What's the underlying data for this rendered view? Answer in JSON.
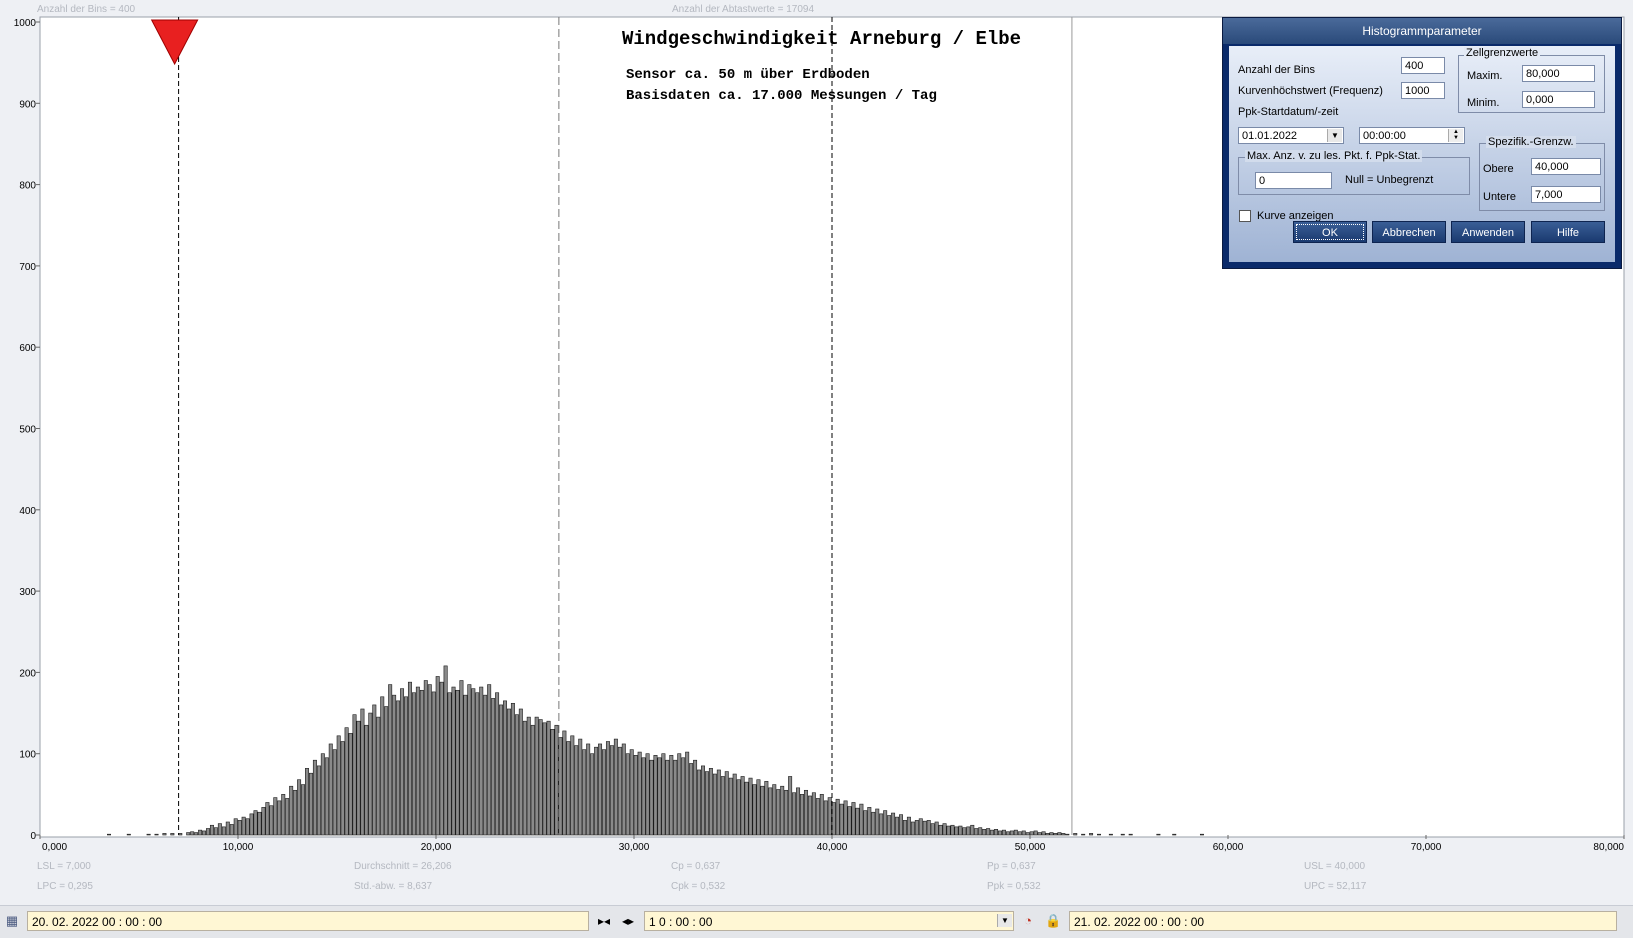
{
  "header": {
    "bins_info": "Anzahl der Bins =   400",
    "samples_info": "Anzahl der Abtastwerte = 17094"
  },
  "chart_title": {
    "line1": "Windgeschwindigkeit  Arneburg / Elbe",
    "line2": "Sensor ca. 50 m über Erdboden",
    "line3": "Basisdaten ca. 17.000 Messungen / Tag"
  },
  "stats": {
    "lsl": "LSL = 7,000",
    "lpc": "LPC = 0,295",
    "mean": "Durchschnitt  = 26,206",
    "std": "Std.-abw. = 8,637",
    "cp": "Cp  = 0,637",
    "cpk": "Cpk = 0,532",
    "pp": "Pp  = 0,637",
    "ppk": "Ppk = 0,532",
    "usl": "USL = 40,000",
    "upc": "UPC = 52,117"
  },
  "chart_data": {
    "type": "bar",
    "xlim": [
      0,
      80
    ],
    "ylim": [
      0,
      1000
    ],
    "xticks": [
      0,
      10,
      20,
      30,
      40,
      50,
      60,
      70,
      80
    ],
    "xtick_labels": [
      "0,000",
      "10,000",
      "20,000",
      "30,000",
      "40,000",
      "50,000",
      "60,000",
      "70,000",
      "80,000"
    ],
    "yticks": [
      0,
      100,
      200,
      300,
      400,
      500,
      600,
      700,
      800,
      900,
      1000
    ],
    "ytick_labels": [
      "0",
      "100",
      "200",
      "300",
      "400",
      "500",
      "600",
      "700",
      "800",
      "900",
      "1000"
    ],
    "bin_width": 0.2,
    "lsl": 7.0,
    "usl": 40.0,
    "mean": 26.206,
    "upc": 52.117,
    "marker_x": 6.8,
    "bins": [
      [
        3.4,
        1
      ],
      [
        4.4,
        1
      ],
      [
        5.4,
        1
      ],
      [
        5.8,
        1
      ],
      [
        6.2,
        2
      ],
      [
        6.6,
        2
      ],
      [
        7.0,
        2
      ],
      [
        7.4,
        3
      ],
      [
        7.6,
        4
      ],
      [
        7.8,
        3
      ],
      [
        8.0,
        6
      ],
      [
        8.2,
        5
      ],
      [
        8.4,
        8
      ],
      [
        8.6,
        12
      ],
      [
        8.8,
        9
      ],
      [
        9.0,
        14
      ],
      [
        9.2,
        10
      ],
      [
        9.4,
        16
      ],
      [
        9.6,
        13
      ],
      [
        9.8,
        20
      ],
      [
        10.0,
        18
      ],
      [
        10.2,
        22
      ],
      [
        10.4,
        20
      ],
      [
        10.6,
        26
      ],
      [
        10.8,
        30
      ],
      [
        11.0,
        28
      ],
      [
        11.2,
        34
      ],
      [
        11.4,
        40
      ],
      [
        11.6,
        36
      ],
      [
        11.8,
        46
      ],
      [
        12.0,
        42
      ],
      [
        12.2,
        50
      ],
      [
        12.4,
        45
      ],
      [
        12.6,
        60
      ],
      [
        12.8,
        55
      ],
      [
        13.0,
        68
      ],
      [
        13.2,
        62
      ],
      [
        13.4,
        82
      ],
      [
        13.6,
        76
      ],
      [
        13.8,
        92
      ],
      [
        14.0,
        85
      ],
      [
        14.2,
        100
      ],
      [
        14.4,
        95
      ],
      [
        14.6,
        112
      ],
      [
        14.8,
        105
      ],
      [
        15.0,
        122
      ],
      [
        15.2,
        115
      ],
      [
        15.4,
        132
      ],
      [
        15.6,
        125
      ],
      [
        15.8,
        148
      ],
      [
        16.0,
        140
      ],
      [
        16.2,
        155
      ],
      [
        16.4,
        135
      ],
      [
        16.6,
        150
      ],
      [
        16.8,
        160
      ],
      [
        17.0,
        145
      ],
      [
        17.2,
        170
      ],
      [
        17.4,
        158
      ],
      [
        17.6,
        185
      ],
      [
        17.8,
        172
      ],
      [
        18.0,
        165
      ],
      [
        18.2,
        180
      ],
      [
        18.4,
        170
      ],
      [
        18.6,
        188
      ],
      [
        18.8,
        175
      ],
      [
        19.0,
        182
      ],
      [
        19.2,
        178
      ],
      [
        19.4,
        190
      ],
      [
        19.6,
        185
      ],
      [
        19.8,
        176
      ],
      [
        20.0,
        195
      ],
      [
        20.2,
        188
      ],
      [
        20.4,
        208
      ],
      [
        20.6,
        175
      ],
      [
        20.8,
        182
      ],
      [
        21.0,
        178
      ],
      [
        21.2,
        190
      ],
      [
        21.4,
        172
      ],
      [
        21.6,
        185
      ],
      [
        21.8,
        180
      ],
      [
        22.0,
        175
      ],
      [
        22.2,
        182
      ],
      [
        22.4,
        172
      ],
      [
        22.6,
        185
      ],
      [
        22.8,
        168
      ],
      [
        23.0,
        175
      ],
      [
        23.2,
        160
      ],
      [
        23.4,
        165
      ],
      [
        23.6,
        155
      ],
      [
        23.8,
        162
      ],
      [
        24.0,
        148
      ],
      [
        24.2,
        155
      ],
      [
        24.4,
        140
      ],
      [
        24.6,
        145
      ],
      [
        24.8,
        135
      ],
      [
        25.0,
        145
      ],
      [
        25.2,
        142
      ],
      [
        25.4,
        138
      ],
      [
        25.6,
        140
      ],
      [
        25.8,
        130
      ],
      [
        26.0,
        135
      ],
      [
        26.2,
        120
      ],
      [
        26.4,
        128
      ],
      [
        26.6,
        115
      ],
      [
        26.8,
        122
      ],
      [
        27.0,
        110
      ],
      [
        27.2,
        118
      ],
      [
        27.4,
        105
      ],
      [
        27.6,
        112
      ],
      [
        27.8,
        100
      ],
      [
        28.0,
        108
      ],
      [
        28.2,
        112
      ],
      [
        28.4,
        105
      ],
      [
        28.6,
        115
      ],
      [
        28.8,
        110
      ],
      [
        29.0,
        118
      ],
      [
        29.2,
        108
      ],
      [
        29.4,
        112
      ],
      [
        29.6,
        100
      ],
      [
        29.8,
        105
      ],
      [
        30.0,
        98
      ],
      [
        30.2,
        102
      ],
      [
        30.4,
        95
      ],
      [
        30.6,
        100
      ],
      [
        30.8,
        92
      ],
      [
        31.0,
        98
      ],
      [
        31.2,
        95
      ],
      [
        31.4,
        100
      ],
      [
        31.6,
        92
      ],
      [
        31.8,
        98
      ],
      [
        32.0,
        92
      ],
      [
        32.2,
        100
      ],
      [
        32.4,
        95
      ],
      [
        32.6,
        102
      ],
      [
        32.8,
        88
      ],
      [
        33.0,
        92
      ],
      [
        33.2,
        80
      ],
      [
        33.4,
        85
      ],
      [
        33.6,
        78
      ],
      [
        33.8,
        82
      ],
      [
        34.0,
        75
      ],
      [
        34.2,
        80
      ],
      [
        34.4,
        72
      ],
      [
        34.6,
        78
      ],
      [
        34.8,
        70
      ],
      [
        35.0,
        75
      ],
      [
        35.2,
        68
      ],
      [
        35.4,
        72
      ],
      [
        35.6,
        65
      ],
      [
        35.8,
        70
      ],
      [
        36.0,
        62
      ],
      [
        36.2,
        68
      ],
      [
        36.4,
        60
      ],
      [
        36.6,
        66
      ],
      [
        36.8,
        58
      ],
      [
        37.0,
        62
      ],
      [
        37.2,
        56
      ],
      [
        37.4,
        60
      ],
      [
        37.6,
        55
      ],
      [
        37.8,
        72
      ],
      [
        38.0,
        52
      ],
      [
        38.2,
        58
      ],
      [
        38.4,
        50
      ],
      [
        38.6,
        55
      ],
      [
        38.8,
        48
      ],
      [
        39.0,
        52
      ],
      [
        39.2,
        45
      ],
      [
        39.4,
        50
      ],
      [
        39.6,
        42
      ],
      [
        39.8,
        46
      ],
      [
        40.0,
        40
      ],
      [
        40.2,
        44
      ],
      [
        40.4,
        38
      ],
      [
        40.6,
        42
      ],
      [
        40.8,
        35
      ],
      [
        41.0,
        40
      ],
      [
        41.2,
        33
      ],
      [
        41.4,
        38
      ],
      [
        41.6,
        30
      ],
      [
        41.8,
        34
      ],
      [
        42.0,
        28
      ],
      [
        42.2,
        32
      ],
      [
        42.4,
        26
      ],
      [
        42.6,
        30
      ],
      [
        42.8,
        24
      ],
      [
        43.0,
        27
      ],
      [
        43.2,
        22
      ],
      [
        43.4,
        25
      ],
      [
        43.6,
        18
      ],
      [
        43.8,
        22
      ],
      [
        44.0,
        16
      ],
      [
        44.2,
        18
      ],
      [
        44.4,
        20
      ],
      [
        44.6,
        17
      ],
      [
        44.8,
        18
      ],
      [
        45.0,
        14
      ],
      [
        45.2,
        16
      ],
      [
        45.4,
        12
      ],
      [
        45.6,
        14
      ],
      [
        45.8,
        11
      ],
      [
        46.0,
        12
      ],
      [
        46.2,
        10
      ],
      [
        46.4,
        11
      ],
      [
        46.6,
        9
      ],
      [
        46.8,
        10
      ],
      [
        47.0,
        12
      ],
      [
        47.2,
        8
      ],
      [
        47.4,
        9
      ],
      [
        47.6,
        7
      ],
      [
        47.8,
        8
      ],
      [
        48.0,
        6
      ],
      [
        48.2,
        7
      ],
      [
        48.4,
        5
      ],
      [
        48.6,
        6
      ],
      [
        48.8,
        4
      ],
      [
        49.0,
        5
      ],
      [
        49.2,
        6
      ],
      [
        49.4,
        4
      ],
      [
        49.6,
        5
      ],
      [
        49.8,
        3
      ],
      [
        50.0,
        4
      ],
      [
        50.2,
        5
      ],
      [
        50.4,
        3
      ],
      [
        50.6,
        4
      ],
      [
        50.8,
        2
      ],
      [
        51.0,
        3
      ],
      [
        51.2,
        2
      ],
      [
        51.4,
        3
      ],
      [
        51.6,
        2
      ],
      [
        51.8,
        1
      ],
      [
        52.2,
        2
      ],
      [
        52.6,
        1
      ],
      [
        53.0,
        2
      ],
      [
        53.4,
        1
      ],
      [
        54.0,
        1
      ],
      [
        54.6,
        1
      ],
      [
        55.0,
        1
      ],
      [
        56.4,
        1
      ],
      [
        57.2,
        1
      ],
      [
        58.6,
        1
      ]
    ]
  },
  "dialog": {
    "title": "Histogrammparameter",
    "bins_label": "Anzahl der Bins",
    "bins_value": "400",
    "curve_max_label": "Kurvenhöchstwert (Frequenz)",
    "curve_max_value": "1000",
    "ppk_start_label": "Ppk-Startdatum/-zeit",
    "start_date": "01.01.2022",
    "start_time": "00:00:00",
    "cell_limits_title": "Zellgrenzwerte",
    "max_label": "Maxim.",
    "max_value": "80,000",
    "min_label": "Minim.",
    "min_value": "0,000",
    "max_points_title": "Max. Anz. v. zu les. Pkt. f. Ppk-Stat.",
    "max_points_value": "0",
    "null_hint": "Null = Unbegrenzt",
    "spec_title": "Spezifik.-Grenzw.",
    "upper_label": "Obere",
    "upper_value": "40,000",
    "lower_label": "Untere",
    "lower_value": "7,000",
    "show_curve_label": "Kurve anzeigen",
    "ok": "OK",
    "cancel": "Abbrechen",
    "apply": "Anwenden",
    "help": "Hilfe"
  },
  "bottom": {
    "start": "20. 02.  2022    00 : 00 : 00",
    "interval": "1  0 : 00 : 00",
    "end": "21. 02.  2022    00 : 00 : 00"
  }
}
